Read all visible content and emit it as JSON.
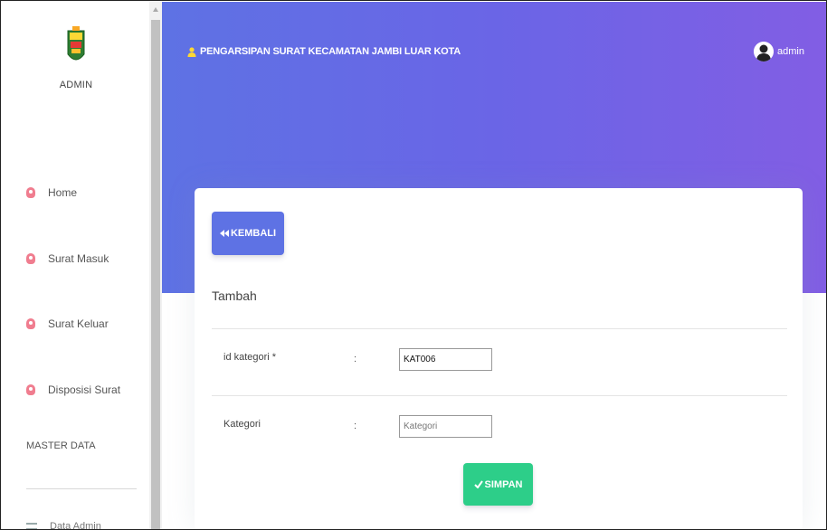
{
  "sidebar": {
    "logo_label": "ADMIN",
    "items": [
      {
        "label": "Home",
        "icon": "user-pin-icon"
      },
      {
        "label": "Surat Masuk",
        "icon": "user-pin-icon"
      },
      {
        "label": "Surat Keluar",
        "icon": "user-pin-icon"
      },
      {
        "label": "Disposisi Surat",
        "icon": "user-pin-icon"
      }
    ],
    "section_label": "MASTER DATA",
    "master_items": [
      {
        "label": "Data Admin",
        "icon": "list-icon"
      }
    ]
  },
  "header": {
    "title": "PENGARSIPAN SURAT KECAMATAN JAMBI LUAR KOTA",
    "username": "admin"
  },
  "card": {
    "back_label": "KEMBALI",
    "title": "Tambah",
    "fields": [
      {
        "label": "id kategori *",
        "colon": ":",
        "value": "KAT006",
        "placeholder": ""
      },
      {
        "label": "Kategori",
        "colon": ":",
        "value": "",
        "placeholder": "Kategori"
      }
    ],
    "save_label": "SIMPAN"
  },
  "colors": {
    "primary": "#5e72e4",
    "success": "#2dce89",
    "header_gradient_end": "#825ee4",
    "nav_icon": "#f07d8f"
  }
}
